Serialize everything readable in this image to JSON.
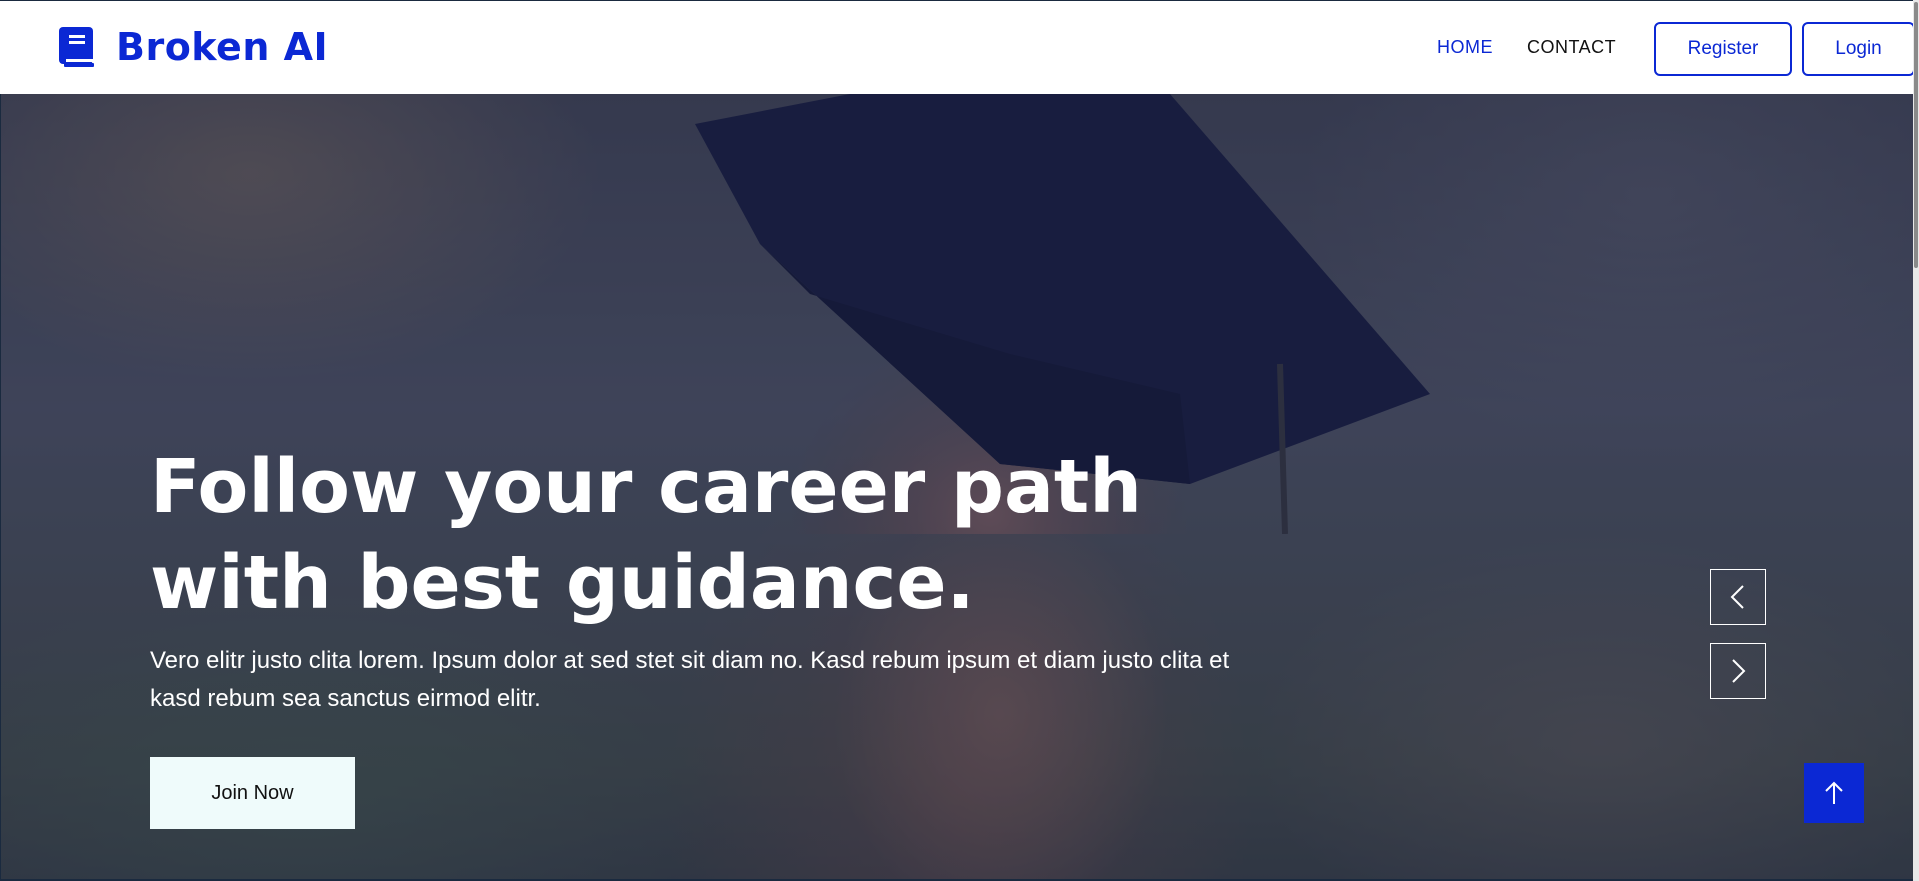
{
  "brand": {
    "name": "Broken AI",
    "icon": "book-icon",
    "color": "#0b28d4"
  },
  "nav": {
    "links": [
      {
        "label": "HOME",
        "active": true
      },
      {
        "label": "CONTACT",
        "active": false
      }
    ],
    "register_label": "Register",
    "login_label": "Login"
  },
  "hero": {
    "title": "Follow your career path with best guidance.",
    "text": "Vero elitr justo clita lorem. Ipsum dolor at sed stet sit diam no. Kasd rebum ipsum et diam justo clita et kasd rebum sea sanctus eirmod elitr.",
    "cta_label": "Join Now",
    "prev_icon": "chevron-left-icon",
    "next_icon": "chevron-right-icon"
  },
  "back_to_top": {
    "icon": "arrow-up-icon",
    "color": "#0b28d4"
  }
}
